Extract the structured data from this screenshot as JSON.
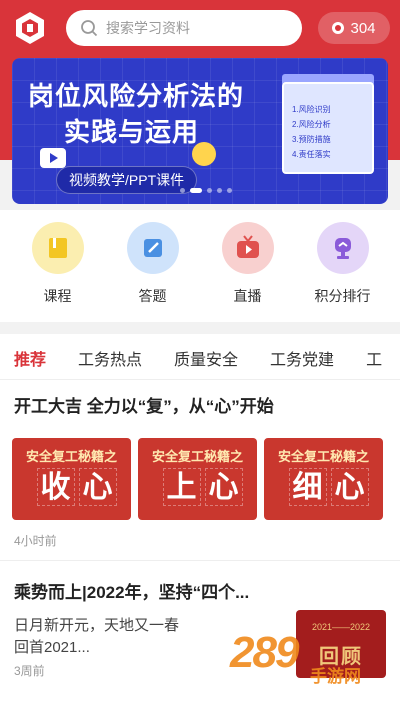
{
  "colors": {
    "brand": "#d9343a",
    "banner_bg": "#2f3bc8",
    "tile_bg": "#c9372e",
    "watermark": "#f08a1c"
  },
  "header": {
    "logo_icon": "app-logo-icon",
    "search_placeholder": "搜索学习资料",
    "points": "304"
  },
  "banner": {
    "title_line1": "岗位风险分析法的",
    "title_line2": "实践与运用",
    "pill": "视频教学/PPT课件",
    "board_items": [
      "1.风险识别",
      "2.风险分析",
      "3.预防措施",
      "4.责任落实"
    ],
    "slide_count": 5,
    "active_slide": 1
  },
  "quick_nav": [
    {
      "label": "课程",
      "icon": "book-icon",
      "color": "#f3d64a"
    },
    {
      "label": "答题",
      "icon": "edit-icon",
      "color": "#4a90e2"
    },
    {
      "label": "直播",
      "icon": "tv-icon",
      "color": "#e0524f"
    },
    {
      "label": "积分排行",
      "icon": "trophy-icon",
      "color": "#8a5bd9"
    }
  ],
  "tabs": [
    "推荐",
    "工务热点",
    "质量安全",
    "工务党建",
    "工"
  ],
  "active_tab": 0,
  "articles": [
    {
      "title": "开工大吉  全力以“复”，从“心”开始",
      "tiles": [
        {
          "caption": "安全复工秘籍之",
          "chars": [
            "收",
            "心"
          ]
        },
        {
          "caption": "安全复工秘籍之",
          "chars": [
            "上",
            "心"
          ]
        },
        {
          "caption": "安全复工秘籍之",
          "chars": [
            "细",
            "心"
          ]
        }
      ],
      "time": "4小时前"
    },
    {
      "title": "乘势而上|2022年，坚持“四个...",
      "summary_line1": "日月新开元，天地又一春",
      "summary_line2": "回首2021...",
      "time": "3周前",
      "thumb_caption": "2021——2022",
      "thumb_text": "回顾"
    }
  ],
  "watermark": {
    "number": "289",
    "text": "手游网"
  }
}
